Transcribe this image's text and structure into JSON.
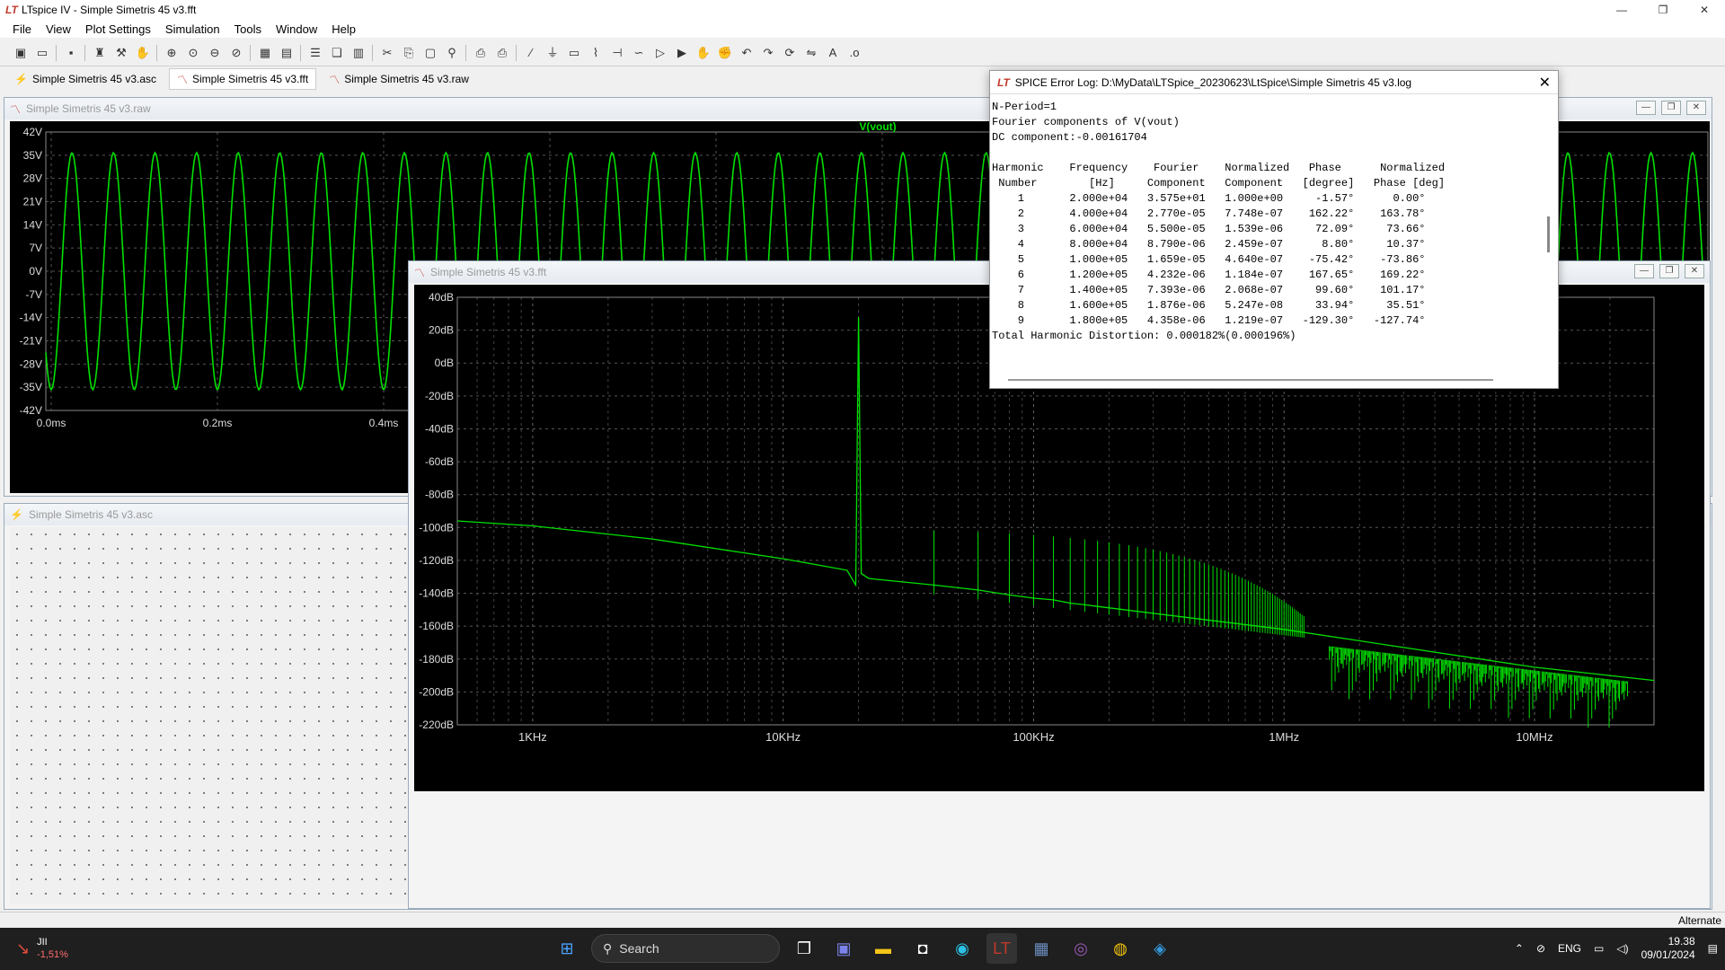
{
  "window": {
    "title": "LTspice IV - Simple Simetris 45 v3.fft",
    "min": "—",
    "max": "❐",
    "close": "✕"
  },
  "menu": [
    "File",
    "View",
    "Plot Settings",
    "Simulation",
    "Tools",
    "Window",
    "Help"
  ],
  "tabs": [
    {
      "label": "Simple Simetris 45 v3.asc",
      "icon": "schematic-icon"
    },
    {
      "label": "Simple Simetris 45 v3.fft",
      "icon": "waveform-icon"
    },
    {
      "label": "Simple Simetris 45 v3.raw",
      "icon": "waveform-icon"
    }
  ],
  "raw_window": {
    "title": "Simple Simetris 45 v3.raw",
    "trace_label": "V(vout)",
    "trace_color": "#00e000",
    "y_ticks": [
      "42V",
      "35V",
      "28V",
      "21V",
      "14V",
      "7V",
      "0V",
      "-7V",
      "-14V",
      "-21V",
      "-28V",
      "-35V",
      "-42V"
    ],
    "x_ticks": [
      "0.0ms",
      "0.2ms",
      "0.4ms"
    ]
  },
  "asc_window": {
    "title": "Simple Simetris 45 v3.asc"
  },
  "fft_window": {
    "title": "Simple Simetris 45 v3.fft",
    "y_ticks": [
      "40dB",
      "20dB",
      "0dB",
      "-20dB",
      "-40dB",
      "-60dB",
      "-80dB",
      "-100dB",
      "-120dB",
      "-140dB",
      "-160dB",
      "-180dB",
      "-200dB",
      "-220dB"
    ],
    "x_ticks": [
      "1KHz",
      "10KHz",
      "100KHz",
      "1MHz",
      "10MHz"
    ]
  },
  "chart_data": [
    {
      "type": "line",
      "series": [
        {
          "name": "V(vout)",
          "frequency_hz": 20000,
          "amplitude_v": 35.75,
          "dc_v": -0.00161704
        }
      ],
      "ylim": [
        -42,
        42
      ],
      "ylabel_unit": "V",
      "xlabel_unit": "ms",
      "grid": true
    },
    {
      "type": "line",
      "series": [
        {
          "name": "",
          "x_hz": [
            500,
            1000,
            3000,
            10000,
            18000,
            19500,
            20000,
            20500,
            22000,
            40000,
            60000,
            80000,
            100000,
            120000,
            140000,
            160000,
            180000,
            1000000,
            10000000,
            30000000
          ],
          "y_db": [
            -96,
            -99,
            -107,
            -119,
            -126,
            -135,
            28,
            -128,
            -131,
            -135,
            -138,
            -141,
            -143,
            -144,
            -146,
            -147,
            -148,
            -162,
            -185,
            -193
          ]
        }
      ],
      "xscale": "log",
      "xlim": [
        500,
        30000000
      ],
      "ylim": [
        -220,
        40
      ],
      "grid": true
    }
  ],
  "error_log": {
    "title": "SPICE Error Log: D:\\MyData\\LTSpice_20230623\\LtSpice\\Simple Simetris 45 v3.log",
    "lines": [
      "N-Period=1",
      "Fourier components of V(vout)",
      "DC component:-0.00161704",
      "",
      "Harmonic    Frequency    Fourier    Normalized   Phase      Normalized",
      " Number        [Hz]     Component   Component   [degree]   Phase [deg]",
      "    1       2.000e+04   3.575e+01   1.000e+00     -1.57°      0.00°",
      "    2       4.000e+04   2.770e-05   7.748e-07    162.22°    163.78°",
      "    3       6.000e+04   5.500e-05   1.539e-06     72.09°     73.66°",
      "    4       8.000e+04   8.790e-06   2.459e-07      8.80°     10.37°",
      "    5       1.000e+05   1.659e-05   4.640e-07    -75.42°    -73.86°",
      "    6       1.200e+05   4.232e-06   1.184e-07    167.65°    169.22°",
      "    7       1.400e+05   7.393e-06   2.068e-07     99.60°    101.17°",
      "    8       1.600e+05   1.876e-06   5.247e-08     33.94°     35.51°",
      "    9       1.800e+05   4.358e-06   1.219e-07   -129.30°   -127.74°",
      "Total Harmonic Distortion: 0.000182%(0.000196%)"
    ]
  },
  "status": {
    "right": "Alternate"
  },
  "taskbar": {
    "stock_name": "JII",
    "stock_change": "-1,51%",
    "search_label": "Search",
    "lang": "ENG",
    "time": "19.38",
    "date": "09/01/2024"
  }
}
